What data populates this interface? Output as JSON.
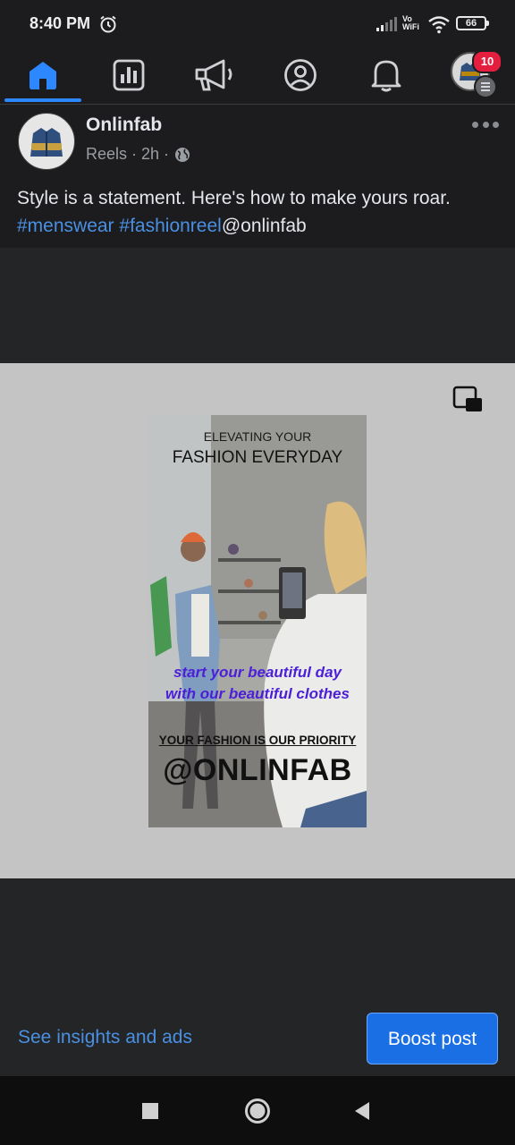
{
  "status_bar": {
    "time": "8:40 PM",
    "vowifi_top": "Vo",
    "vowifi_bottom": "WiFi",
    "battery": "66"
  },
  "nav": {
    "items": [
      {
        "icon": "home-icon",
        "active": true
      },
      {
        "icon": "insights-icon"
      },
      {
        "icon": "megaphone-icon"
      },
      {
        "icon": "profile-icon"
      },
      {
        "icon": "bell-icon"
      }
    ],
    "notification_count": "10",
    "accent_color": "#2d88ff"
  },
  "post": {
    "page_name": "Onlinfab",
    "meta": "Reels · 2h ·",
    "caption_text": "Style is a statement. Here's how to make yours roar. ",
    "hashtag_1": "#menswear",
    "hashtag_2": "#fashionreel",
    "mention": "@onlinfab"
  },
  "reel": {
    "line1": "ELEVATING YOUR",
    "line2": "FASHION EVERYDAY",
    "tagline1": "start your beautiful day",
    "tagline2": "with our beautiful clothes",
    "priority": "YOUR FASHION IS OUR PRIORITY",
    "handle": "@ONLINFAB"
  },
  "actions": {
    "insights_link": "See insights and ads",
    "boost_button": "Boost post"
  },
  "link_color": "#4a90e2",
  "button_color": "#1b6fe4"
}
